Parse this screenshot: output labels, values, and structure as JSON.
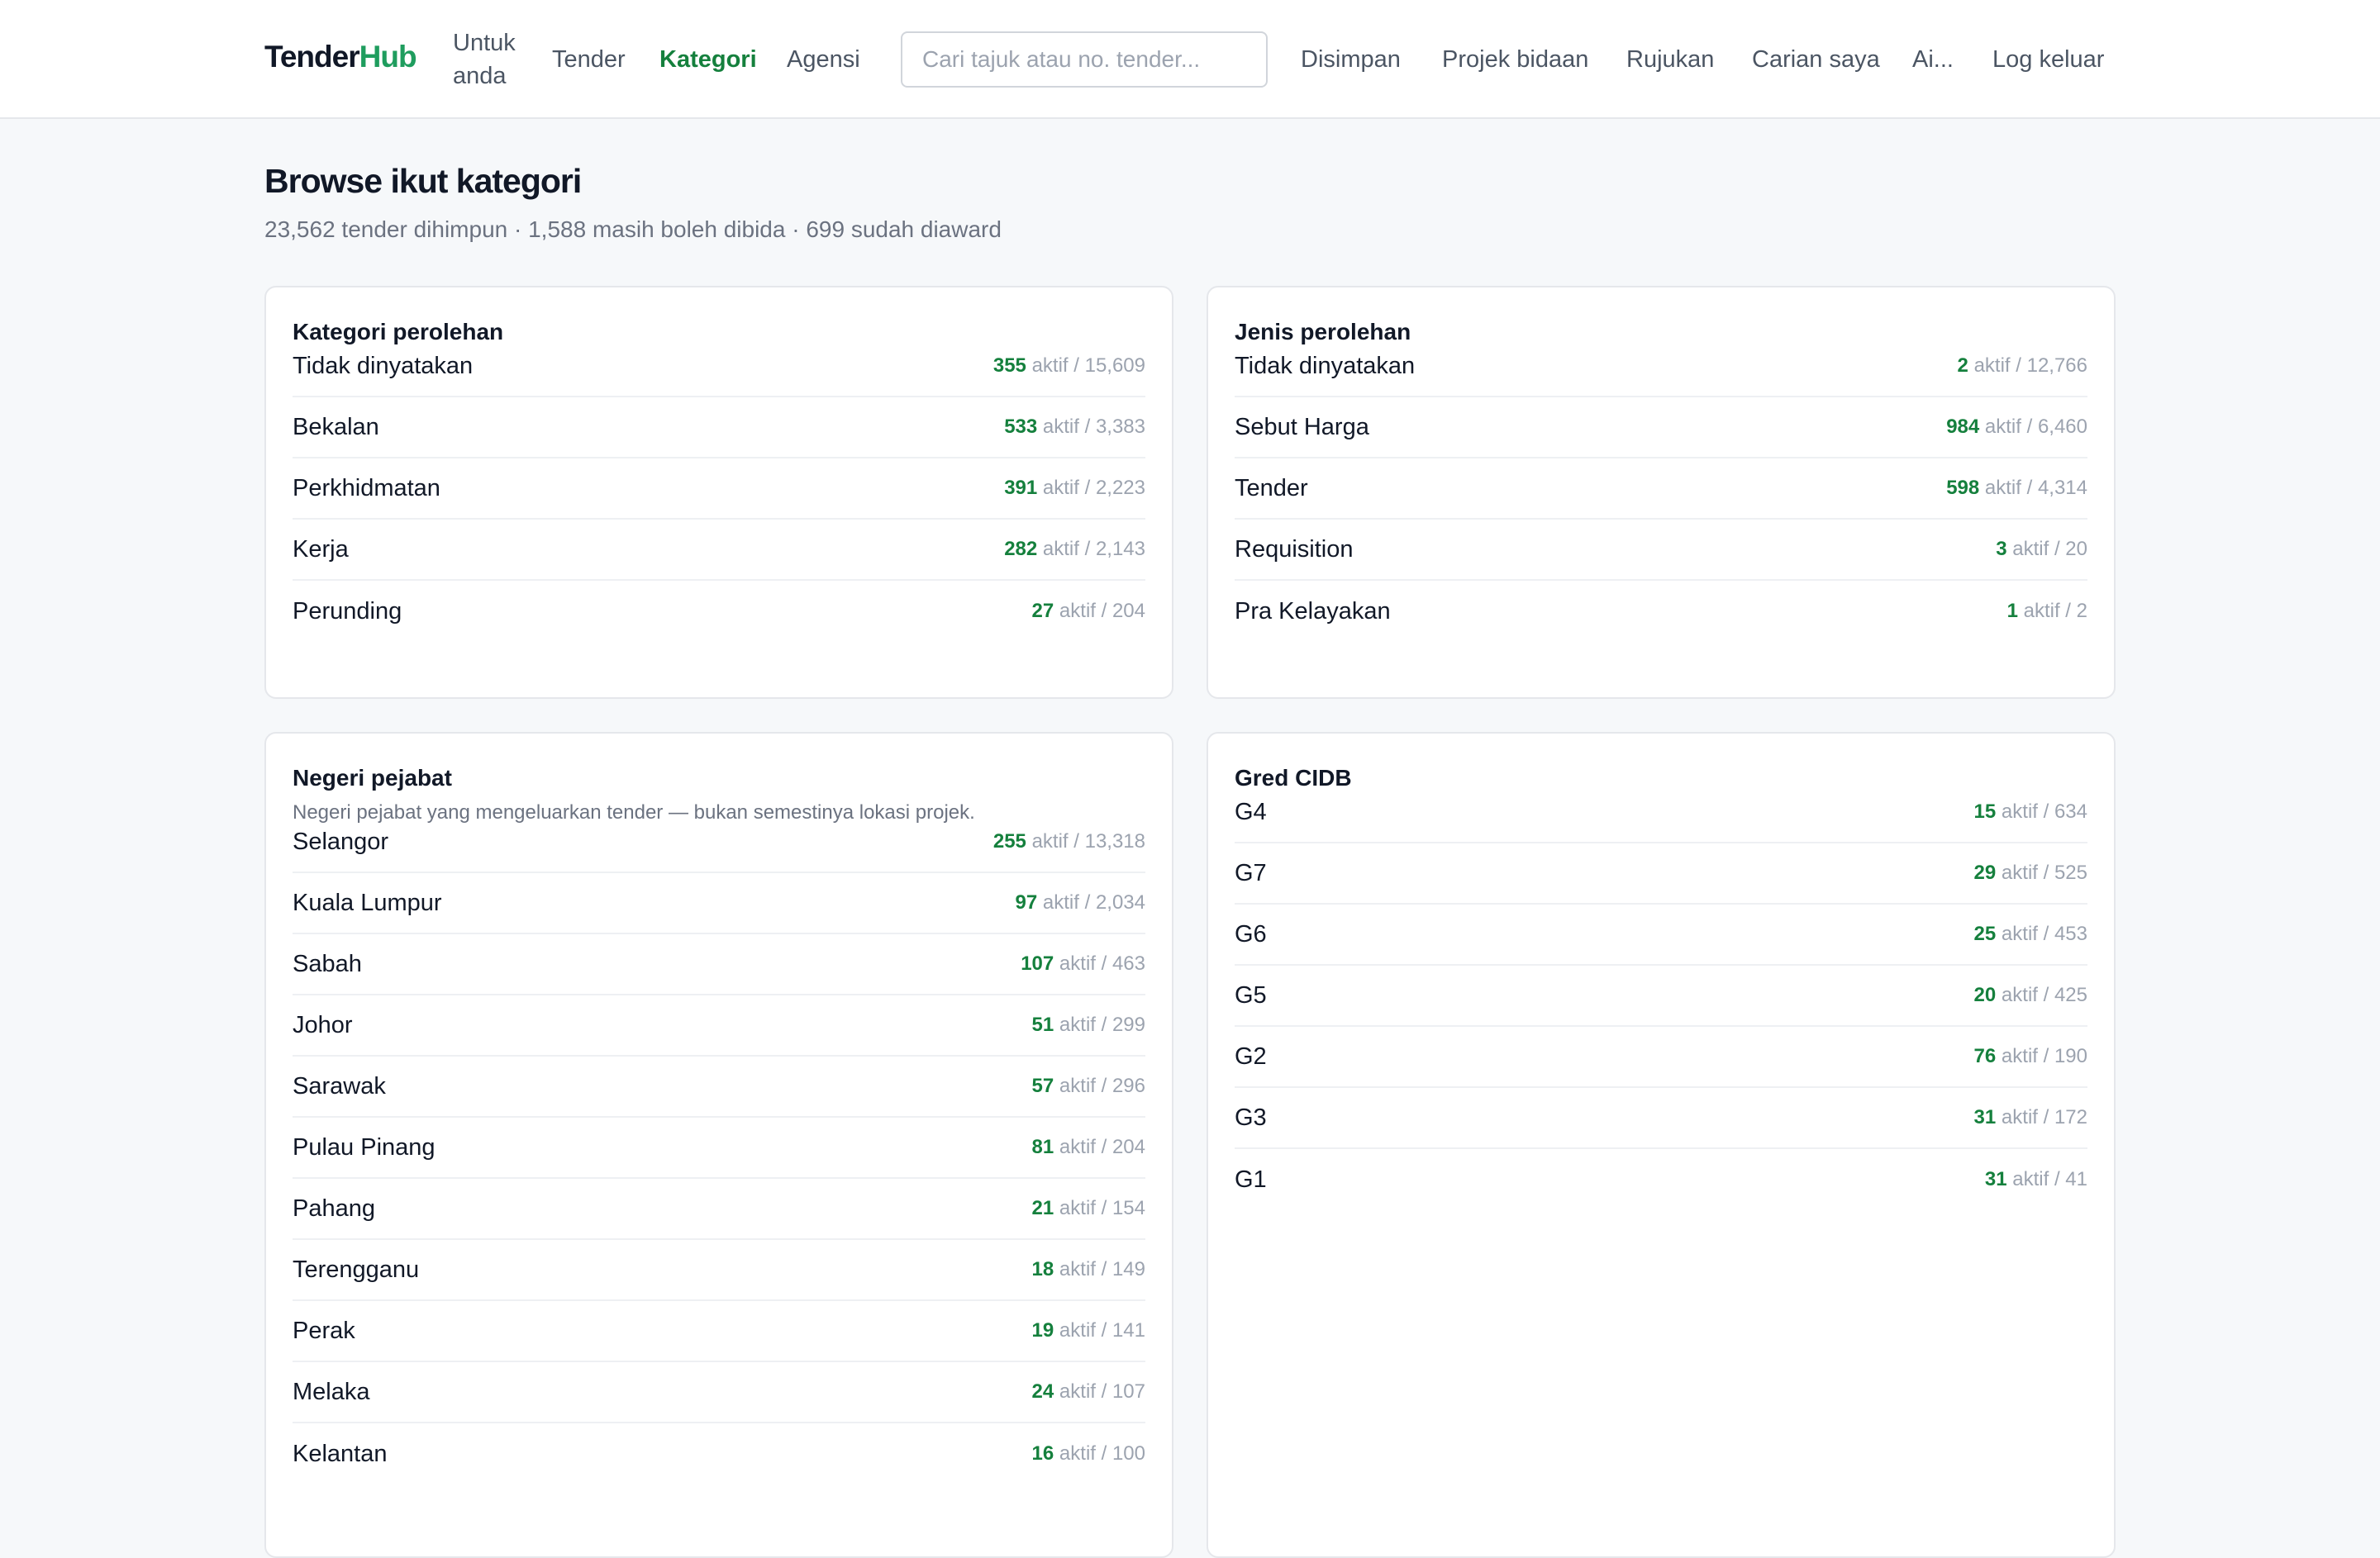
{
  "header": {
    "logo_part1": "Tender",
    "logo_part2": "Hub",
    "nav": {
      "for_you_line1": "Untuk",
      "for_you_line2": "anda",
      "tender": "Tender",
      "kategori": "Kategori",
      "agensi": "Agensi",
      "disimpan": "Disimpan",
      "projek_bidaan": "Projek bidaan",
      "rujukan": "Rujukan",
      "carian_saya": "Carian saya",
      "ai": "Ai...",
      "log_keluar": "Log keluar"
    },
    "search_placeholder": "Cari tajuk atau no. tender...",
    "search_value": ""
  },
  "page": {
    "title": "Browse ikut kategori",
    "summary": "23,562 tender dihimpun · 1,588 masih boleh dibida · 699 sudah diaward"
  },
  "active_word": "aktif /",
  "colors": {
    "accent": "#15803d",
    "brand": "#1f9d5e",
    "muted": "#9ca3af"
  },
  "cards": {
    "kategori": {
      "title": "Kategori perolehan",
      "rows": [
        {
          "label": "Tidak dinyatakan",
          "active": "355",
          "total": "15,609"
        },
        {
          "label": "Bekalan",
          "active": "533",
          "total": "3,383"
        },
        {
          "label": "Perkhidmatan",
          "active": "391",
          "total": "2,223"
        },
        {
          "label": "Kerja",
          "active": "282",
          "total": "2,143"
        },
        {
          "label": "Perunding",
          "active": "27",
          "total": "204"
        }
      ]
    },
    "jenis": {
      "title": "Jenis perolehan",
      "rows": [
        {
          "label": "Tidak dinyatakan",
          "active": "2",
          "total": "12,766"
        },
        {
          "label": "Sebut Harga",
          "active": "984",
          "total": "6,460"
        },
        {
          "label": "Tender",
          "active": "598",
          "total": "4,314"
        },
        {
          "label": "Requisition",
          "active": "3",
          "total": "20"
        },
        {
          "label": "Pra Kelayakan",
          "active": "1",
          "total": "2"
        }
      ]
    },
    "negeri": {
      "title": "Negeri pejabat",
      "note": "Negeri pejabat yang mengeluarkan tender — bukan semestinya lokasi projek.",
      "rows": [
        {
          "label": "Selangor",
          "active": "255",
          "total": "13,318"
        },
        {
          "label": "Kuala Lumpur",
          "active": "97",
          "total": "2,034"
        },
        {
          "label": "Sabah",
          "active": "107",
          "total": "463"
        },
        {
          "label": "Johor",
          "active": "51",
          "total": "299"
        },
        {
          "label": "Sarawak",
          "active": "57",
          "total": "296"
        },
        {
          "label": "Pulau Pinang",
          "active": "81",
          "total": "204"
        },
        {
          "label": "Pahang",
          "active": "21",
          "total": "154"
        },
        {
          "label": "Terengganu",
          "active": "18",
          "total": "149"
        },
        {
          "label": "Perak",
          "active": "19",
          "total": "141"
        },
        {
          "label": "Melaka",
          "active": "24",
          "total": "107"
        },
        {
          "label": "Kelantan",
          "active": "16",
          "total": "100"
        }
      ]
    },
    "gred": {
      "title": "Gred CIDB",
      "rows": [
        {
          "label": "G4",
          "active": "15",
          "total": "634"
        },
        {
          "label": "G7",
          "active": "29",
          "total": "525"
        },
        {
          "label": "G6",
          "active": "25",
          "total": "453"
        },
        {
          "label": "G5",
          "active": "20",
          "total": "425"
        },
        {
          "label": "G2",
          "active": "76",
          "total": "190"
        },
        {
          "label": "G3",
          "active": "31",
          "total": "172"
        },
        {
          "label": "G1",
          "active": "31",
          "total": "41"
        }
      ]
    }
  }
}
